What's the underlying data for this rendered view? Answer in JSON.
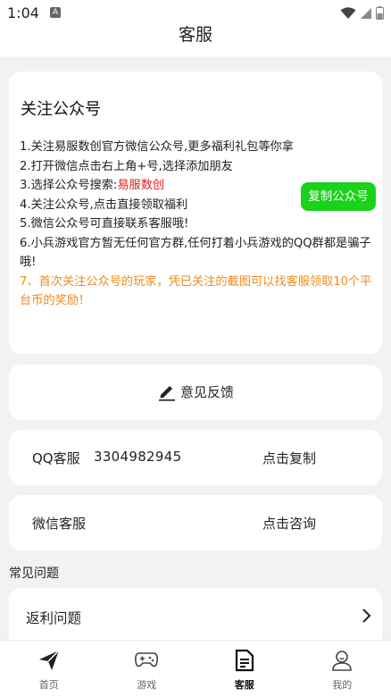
{
  "status_bar": {
    "time": "1:04",
    "notification_glyph": "A"
  },
  "header": {
    "title": "客服"
  },
  "official_account": {
    "title": "关注公众号",
    "line1": "1.关注易服数创官方微信公众号,更多福利礼包等你拿",
    "line2": "2.打开微信点击右上角+号,选择添加朋友",
    "line3_prefix": "3.选择公众号搜索:",
    "line3_highlight": "易服数创",
    "line4": "4.关注公众号,点击直接领取福利",
    "line5": "5.微信公众号可直接联系客服哦!",
    "line6": "6.小兵游戏官方暂无任何官方群,任何打着小兵游戏的QQ群都是骗子哦!",
    "line7": "7、首次关注公众号的玩家，凭已关注的截图可以找客服领取10个平台币的奖励！",
    "copy_button": "复制公众号"
  },
  "feedback": {
    "label": "意见反馈"
  },
  "qq_service": {
    "label": "QQ客服",
    "value": "3304982945",
    "action": "点击复制"
  },
  "wechat_service": {
    "label": "微信客服",
    "action": "点击咨询"
  },
  "faq": {
    "heading": "常见问题",
    "items": [
      {
        "label": "返利问题"
      }
    ]
  },
  "tabbar": {
    "items": [
      {
        "label": "首页",
        "icon": "paper-plane-icon"
      },
      {
        "label": "游戏",
        "icon": "gamepad-icon"
      },
      {
        "label": "客服",
        "icon": "document-icon",
        "active": true
      },
      {
        "label": "我的",
        "icon": "user-icon"
      }
    ]
  },
  "colors": {
    "accent_green": "#19d219",
    "highlight_red": "#e02020",
    "highlight_orange": "#f08a1c",
    "background": "#f2f2f2"
  }
}
